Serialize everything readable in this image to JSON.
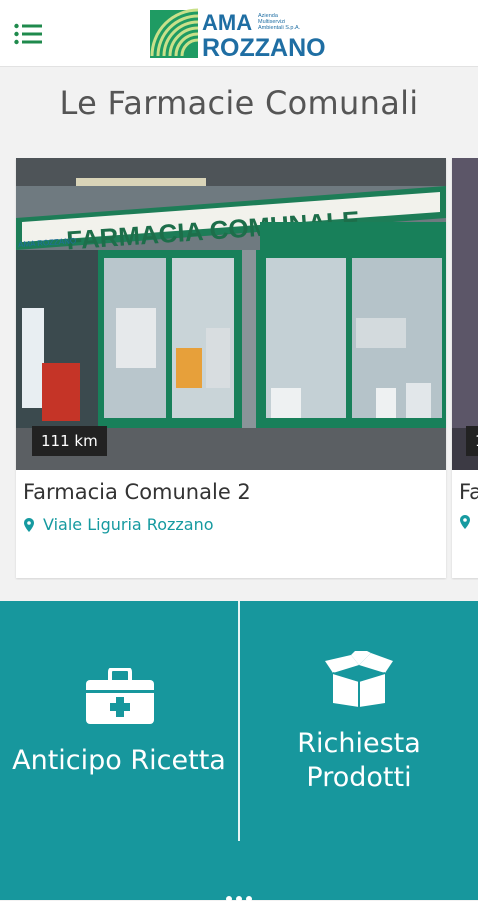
{
  "header": {
    "menu_icon": "hamburger-menu-icon",
    "logo": {
      "line1": "AMA",
      "line2": "ROZZANO",
      "tagline_1": "Azienda",
      "tagline_2": "Multiservizi",
      "tagline_3": "Ambientali S.p.A."
    }
  },
  "page_title": "Le Farmacie Comunali",
  "pharmacies": [
    {
      "name": "Farmacia Comunale 2",
      "address": "Viale Liguria Rozzano",
      "distance": "111 km",
      "sign": "FARMACIA COMUNALE",
      "sign_small": "AMA ROZZANO"
    },
    {
      "name": "Fa",
      "address": "",
      "distance": "1"
    }
  ],
  "actions": [
    {
      "label": "Anticipo Ricetta",
      "icon": "first-aid-kit-icon"
    },
    {
      "label": "Richiesta Prodotti",
      "icon": "open-box-icon"
    }
  ],
  "colors": {
    "accent": "#17979d",
    "link": "#169aa0",
    "brand_green": "#1f9b63",
    "brand_blue": "#1f6ea3"
  }
}
